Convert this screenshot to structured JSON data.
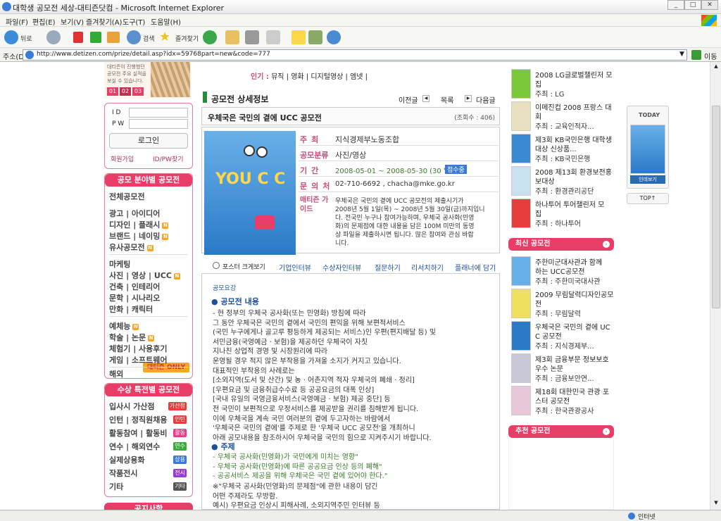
{
  "window": {
    "title": "대학생 공모전 세상-대티즌닷컴 - Microsoft Internet Explorer"
  },
  "menu": [
    "파일(F)",
    "편집(E)",
    "보기(V)",
    "즐겨찾기(A)",
    "도구(T)",
    "도움말(H)"
  ],
  "toolbar": {
    "back": "뒤로",
    "search": "검색",
    "favorites": "즐겨찾기"
  },
  "address": {
    "label": "주소(D)",
    "url": "http://www.detizen.com/prize/detail.asp?idx=59768part=new&code=777",
    "go": "이동"
  },
  "topnav": {
    "popular": "인기 :",
    "items": [
      "뮤직",
      "영화",
      "디지털영상",
      "엠넷"
    ]
  },
  "left": {
    "banner_text": "대티즌이 진행했던 공모전 주요 실적을 보실 수 있습니다.",
    "banner_tabs": [
      "01",
      "02",
      "03"
    ],
    "login": {
      "id": "I D",
      "pw": "P W",
      "button": "로그인",
      "join": "회원가입",
      "find": "ID/PW찾기"
    },
    "cat_head": "공모 분야별 공모전",
    "categories": [
      {
        "label": "전체공모전",
        "new": false
      },
      {
        "label": "광고 | 아이디어",
        "new": false
      },
      {
        "label": "디자인 | 플래시",
        "new": true
      },
      {
        "label": "브랜드 | 네이밍",
        "new": true
      },
      {
        "label": "유사공모전",
        "new": true
      },
      {
        "label": "마케팅",
        "new": false
      },
      {
        "label": "사진 | 영상 | UCC",
        "new": true
      },
      {
        "label": "건축 | 인테리어",
        "new": false
      },
      {
        "label": "문학 | 시나리오",
        "new": false
      },
      {
        "label": "만화 | 캐릭터",
        "new": false
      },
      {
        "label": "예체능",
        "new": true
      },
      {
        "label": "학술 | 논문",
        "new": true
      },
      {
        "label": "체험기 | 사용후기",
        "new": false
      },
      {
        "label": "게임 | 소프트웨어",
        "new": false
      },
      {
        "label": "해외",
        "new": false
      }
    ],
    "detizen_only": "대티즌 ONLY",
    "special_head": "수상 특전별 공모전",
    "specials": [
      {
        "label": "입사시 가산점",
        "tag": "가산점",
        "color": "#e83d3d"
      },
      {
        "label": "인턴 | 정직원채용",
        "tag": "인턴",
        "color": "#e83d3d"
      },
      {
        "label": "활동참여 | 활동비",
        "tag": "활동",
        "color": "#e83d8a"
      },
      {
        "label": "연수 | 해외연수",
        "tag": "연수",
        "color": "#3aa83a"
      },
      {
        "label": "실제상용화",
        "tag": "상용",
        "color": "#3a7ad5"
      },
      {
        "label": "작품전시",
        "tag": "전시",
        "color": "#9a3ad5"
      },
      {
        "label": "기타",
        "tag": "기타",
        "color": "#555555"
      }
    ],
    "bottom_head": "공지사항"
  },
  "main": {
    "section_title": "공모전 상세정보",
    "prev": "이전글",
    "list": "목록",
    "next": "다음글",
    "contest_title": "우체국은 국민의 곁에 UCC 공모전",
    "views": "(조회수 : 406)",
    "poster_text": "YOU C C",
    "fields": {
      "host_k": "주최",
      "host": "지식경제부노동조합",
      "cat_k": "공모분류",
      "cat": "사진/영상",
      "period_k": "기간",
      "period": "2008-05-01 ~ 2008-05-30 (30 일간)",
      "status": "접수중",
      "contact_k": "문의처",
      "contact": "02-710-6692 , chacha@mke.go.kr",
      "desc_k": "매티즌 가이드"
    },
    "guide": [
      "우체국은 국민의 곁에 UCC 공모전의 제출시기가",
      "2008년 5월 1일(목) ~ 2008년 5월 30일(금)까지입니",
      "다. 전국민 누구나 참여가능하며, 우체국 공사화(민영",
      "화)의 문제점에 대한 내용을 담은 100M 미만의 동영",
      "상 파일을 제출하시면 됩니다. 많은 참여와 관심 바랍",
      "니다."
    ],
    "poster_zoom": "포스터 크게보기",
    "tabs": [
      "기업인터뷰",
      "수상자인터뷰",
      "질문하기",
      "리서치하기",
      "플래너에 담기"
    ],
    "body_label": "공모요강",
    "sec1": "공모전 내용",
    "lines1": [
      "- 현 정부의 우체국 공사화(또는 민영화) 방침에 따라",
      "  그 동안 우체국은 국민의 곁에서 국민의 편익을 위해 보편적서비스",
      "  (국민 누구에게나 골고루 평등하게 제공되는 서비스)인 우편(편지배달 등) 및",
      "  서민금융(국영예금 · 보험)을 제공하던 우체국이 자칫",
      "  지나친 상업적 경영 및 시장원리에 따라",
      "  운영될 경우 적지 않은 부작용을 가져올 소지가 커지고 있습니다.",
      "  대표적인 부작용의 사례로는",
      "  [소외지역(도서 및 산간) 및 농 · 어촌지역 적자 우체국의 폐쇄 · 정리]",
      "  [우편요금 및 금융취급수수료 등 공공요금의 대폭 인상]",
      "  [국내 유일의 국영금융서비스(국영예금 · 보험) 제공 중단] 등",
      "  전 국민이 보편적으로 우정서비스를 제공받을 권리를 침해받게 됩니다.",
      "  이에 우체국을 계속 국민 여러분의 곁에 두고자하는 바람에서",
      "  '우체국은 국민의 곁에'를 주제로 한 '우체국 UCC 공모전'을 개최하니",
      "  아래 공모내용을 참조하시어 우체국을 국민의 힘으로 지켜주시기 바랍니다."
    ],
    "sec2": "주제",
    "lines2": [
      "- 우체국 공사화(민영화)가 국민에게 미치는 영향\"",
      "- 우체국 공사화(민영화)에 따른 공공요금 인상 등의 폐해\"",
      "- 공공서비스 제공을 위해 우체국은 국민 곁에 있어야 한다.\""
    ],
    "lines3": [
      "※\"우체국 공사화(민영화)의 문제점\"에 관한 내용이 담긴",
      "   어떤 주제라도 무방함.",
      "  예시) 우편요금 인상시 피해사례, 소외지역주민 인터뷰 등"
    ]
  },
  "right": {
    "top_items": [
      {
        "title1": "2008 LG글로벌챌린저 모",
        "title2": "집",
        "host": "주최 : LG"
      },
      {
        "title1": "이메진컵 2008 프랑스 대",
        "title2": "회",
        "host": "주최 : 교육인적자..."
      },
      {
        "title1": "제3회 KB국민은행 대학생",
        "title2": "대상 신상품...",
        "host": "주최 : KB국민은행"
      },
      {
        "title1": "2008 제13회 환경보전홍",
        "title2": "보대상",
        "host": "주최 : 환경관리공단"
      },
      {
        "title1": "하나투어 투어챌린저 모",
        "title2": "집",
        "host": "주최 : 하나투어"
      }
    ],
    "recent_head": "최신 공모전",
    "recent_items": [
      {
        "title1": "주한미군대사관과 함께",
        "title2": "하는 UCC공모전",
        "host": "주최 : 주한미국대사관"
      },
      {
        "title1": "2009 무림달력디자인공모",
        "title2": "전",
        "host": "주최 : 무림달력"
      },
      {
        "title1": "우체국은 국민의 곁에 UC",
        "title2": "C 공모전",
        "host": "주최 : 지식경제부..."
      },
      {
        "title1": "제3회 금융부문 정보보호",
        "title2": "우수 논문",
        "host": "주최 : 금융보안연..."
      },
      {
        "title1": "제18회 대한민국 관광 포",
        "title2": "스터 공모전",
        "host": "주최 : 한국관광공사"
      }
    ],
    "recommend_head": "추천 공모전",
    "today": "TODAY",
    "today_btn": "인데보기",
    "top_btn": "TOP↑"
  },
  "status": {
    "zone": "인터넷"
  }
}
